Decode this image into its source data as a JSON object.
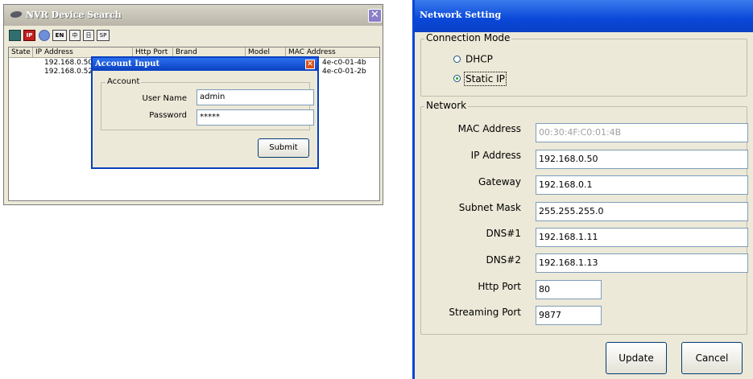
{
  "nvr_window": {
    "title": "NVR Device Search",
    "close_glyph": "✕",
    "toolbar": {
      "gear_icon": "gear-icon",
      "ip_label": "IP",
      "info_icon": "info-icon",
      "en_label": "EN",
      "zh_label": "中",
      "monitor_label": "日",
      "sp_label": "SP"
    },
    "columns": [
      "State",
      "IP Address",
      "Http Port",
      "Brand",
      "Model",
      "MAC Address"
    ],
    "rows": [
      {
        "ip": "192.168.0.50",
        "mac": "4e-c0-01-4b"
      },
      {
        "ip": "192.168.0.52",
        "mac": "4e-c0-01-2b"
      }
    ]
  },
  "account_dialog": {
    "title": "Account Input",
    "close_glyph": "✕",
    "group_label": "Account",
    "username_label": "User Name",
    "username_value": "admin",
    "password_label": "Password",
    "password_value": "*****",
    "submit_label": "Submit"
  },
  "network_window": {
    "title": "Network Setting",
    "connection_mode": {
      "label": "Connection Mode",
      "dhcp_label": "DHCP",
      "static_label": "Static IP",
      "selected": "Static IP"
    },
    "network_group_label": "Network",
    "fields": {
      "mac_label": "MAC Address",
      "mac_value": "00:30:4F:C0:01:4B",
      "ip_label": "IP Address",
      "ip_value": "192.168.0.50",
      "gateway_label": "Gateway",
      "gateway_value": "192.168.0.1",
      "subnet_label": "Subnet Mask",
      "subnet_value": "255.255.255.0",
      "dns1_label": "DNS#1",
      "dns1_value": "192.168.1.11",
      "dns2_label": "DNS#2",
      "dns2_value": "192.168.1.13",
      "http_label": "Http Port",
      "http_value": "80",
      "streaming_label": "Streaming Port",
      "streaming_value": "9877"
    },
    "update_label": "Update",
    "cancel_label": "Cancel"
  },
  "colors": {
    "xp_blue_title": "#0a48d8",
    "dialog_face": "#ece9d8",
    "nvr_title": "#c8c5b8"
  }
}
